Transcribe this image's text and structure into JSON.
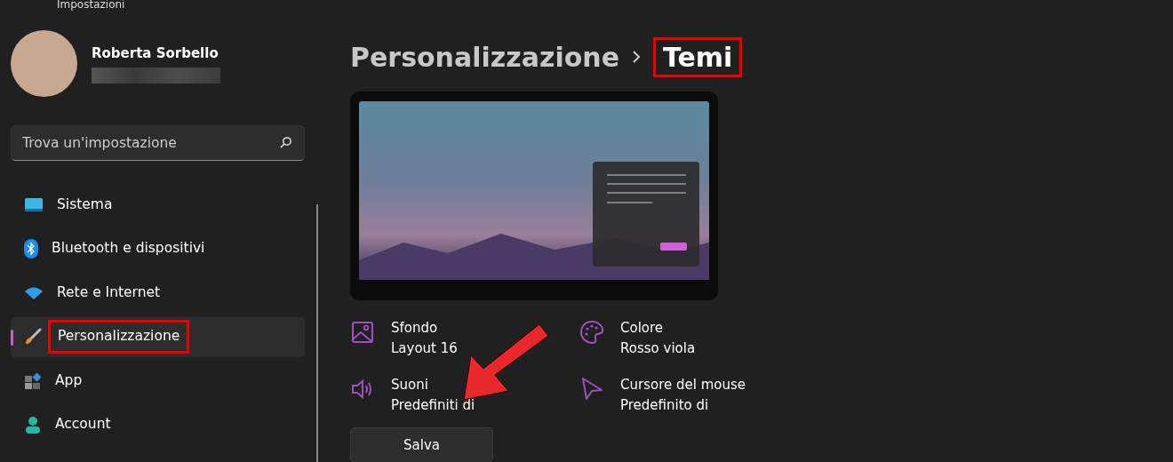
{
  "window": {
    "title": "Impostazioni"
  },
  "profile": {
    "name": "Roberta Sorbello"
  },
  "search": {
    "placeholder": "Trova un'impostazione"
  },
  "nav": [
    {
      "label": "Sistema",
      "kind": "system",
      "selected": false,
      "highlighted": false
    },
    {
      "label": "Bluetooth e dispositivi",
      "kind": "bluetooth",
      "selected": false,
      "highlighted": false
    },
    {
      "label": "Rete e Internet",
      "kind": "wifi",
      "selected": false,
      "highlighted": false
    },
    {
      "label": "Personalizzazione",
      "kind": "brush",
      "selected": true,
      "highlighted": true
    },
    {
      "label": "App",
      "kind": "apps",
      "selected": false,
      "highlighted": false
    },
    {
      "label": "Account",
      "kind": "account",
      "selected": false,
      "highlighted": false
    }
  ],
  "breadcrumb": [
    {
      "label": "Personalizzazione",
      "current": false,
      "highlighted": false
    },
    {
      "label": "Temi",
      "current": true,
      "highlighted": true
    }
  ],
  "theme_settings": [
    {
      "kind": "picture",
      "label": "Sfondo",
      "value": "Layout 16"
    },
    {
      "kind": "palette",
      "label": "Colore",
      "value": "Rosso viola"
    },
    {
      "kind": "sound",
      "label": "Suoni",
      "value": "Predefiniti di"
    },
    {
      "kind": "cursor",
      "label": "Cursore del mouse",
      "value": "Predefinito di"
    }
  ],
  "save_button": {
    "label": "Salva"
  }
}
